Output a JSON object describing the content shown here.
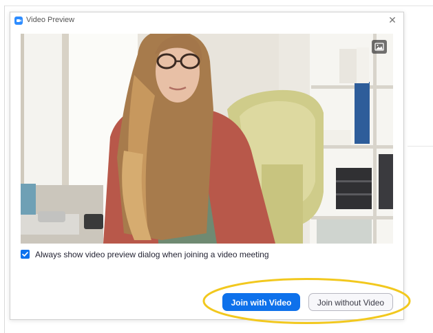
{
  "dialog": {
    "title": "Video Preview",
    "close_glyph": "✕"
  },
  "video": {
    "background_button_icon": "image-icon"
  },
  "options": {
    "always_show_preview_checked": true,
    "always_show_preview_label": "Always show video preview dialog when joining a video meeting"
  },
  "buttons": {
    "join_with_video": "Join with Video",
    "join_without_video": "Join without Video"
  },
  "colors": {
    "accent": "#0e72ed",
    "highlight": "#f2c81e"
  }
}
